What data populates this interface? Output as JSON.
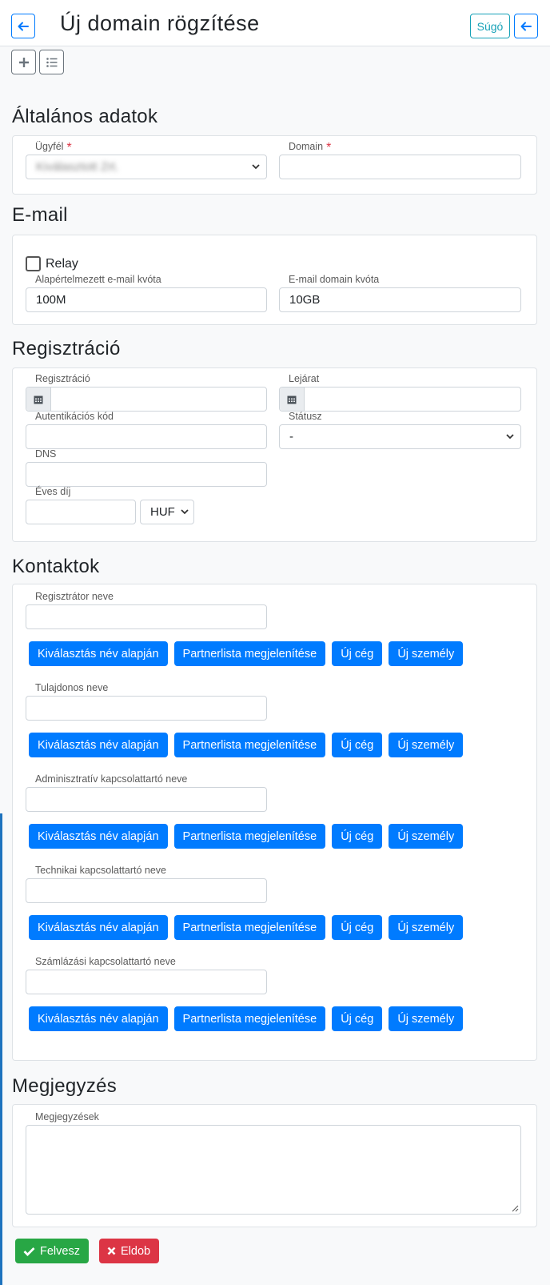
{
  "header": {
    "title": "Új domain rögzítése",
    "help_label": "Súgó"
  },
  "sections": {
    "general": "Általános adatok",
    "email": "E-mail",
    "registration": "Regisztráció",
    "contacts": "Kontaktok",
    "notes": "Megjegyzés"
  },
  "general": {
    "client_label": "Ügyfél",
    "client_value": "Kiválasztott Zrt.",
    "domain_label": "Domain",
    "domain_value": "",
    "required_mark": "*"
  },
  "email": {
    "relay_label": "Relay",
    "relay_checked": false,
    "default_quota_label": "Alapértelmezett e-mail kvóta",
    "default_quota_value": "100M",
    "domain_quota_label": "E-mail domain kvóta",
    "domain_quota_value": "10GB"
  },
  "registration": {
    "reg_label": "Regisztráció",
    "expiry_label": "Lejárat",
    "auth_label": "Autentikációs kód",
    "status_label": "Státusz",
    "status_value": "-",
    "dns_label": "DNS",
    "fee_label": "Éves díj",
    "currency_value": "HUF"
  },
  "contacts": {
    "buttons": {
      "select_by_name": "Kiválasztás név alapján",
      "show_partners": "Partnerlista megjelenítése",
      "new_company": "Új cég",
      "new_person": "Új személy"
    },
    "items": [
      {
        "label": "Regisztrátor neve"
      },
      {
        "label": "Tulajdonos neve"
      },
      {
        "label": "Adminisztratív kapcsolattartó neve"
      },
      {
        "label": "Technikai kapcsolattartó neve"
      },
      {
        "label": "Számlázási kapcsolattartó neve"
      }
    ]
  },
  "notes": {
    "label": "Megjegyzések"
  },
  "actions": {
    "save": "Felvesz",
    "discard": "Eldob"
  },
  "colors": {
    "primary": "#007bff",
    "success": "#28a745",
    "danger": "#dc3545",
    "info": "#17a2b8"
  }
}
